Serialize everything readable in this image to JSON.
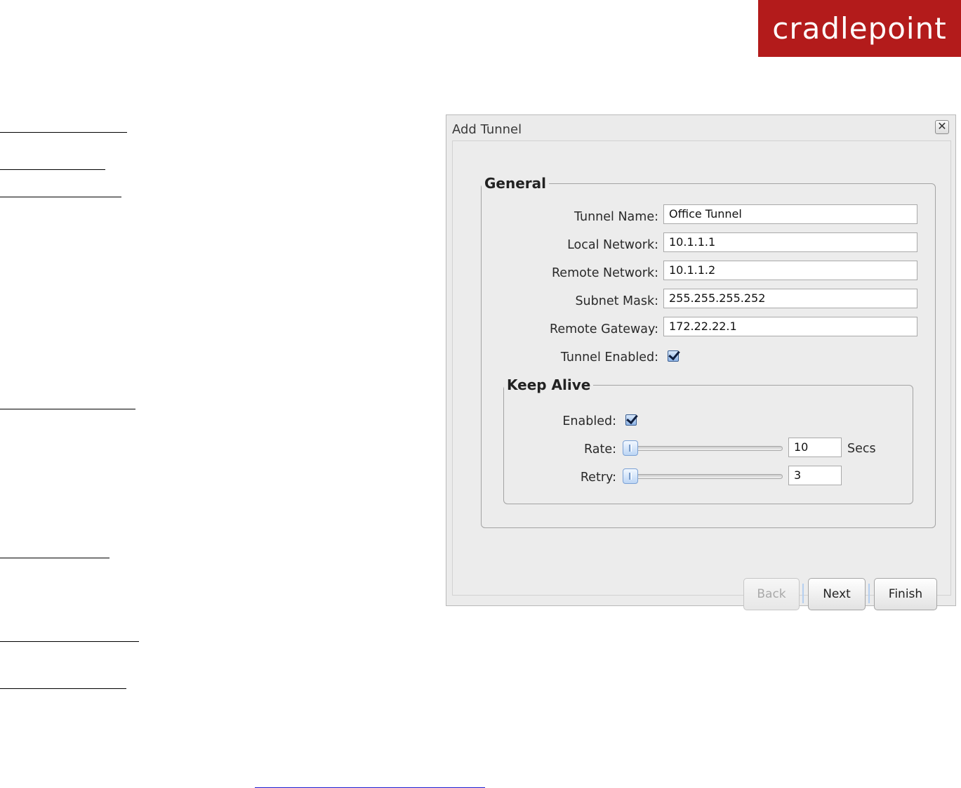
{
  "brand": {
    "logo_text": "cradlepoint",
    "color": "#b31b1b"
  },
  "dialog": {
    "title": "Add Tunnel",
    "close_icon": "close-icon",
    "general": {
      "legend": "General",
      "fields": [
        {
          "label": "Tunnel Name:",
          "value": "Office Tunnel"
        },
        {
          "label": "Local Network:",
          "value": "10.1.1.1"
        },
        {
          "label": "Remote Network:",
          "value": "10.1.1.2"
        },
        {
          "label": "Subnet Mask:",
          "value": "255.255.255.252"
        },
        {
          "label": "Remote Gateway:",
          "value": "172.22.22.1"
        }
      ],
      "tunnel_enabled": {
        "label": "Tunnel Enabled:",
        "checked": true
      }
    },
    "keep_alive": {
      "legend": "Keep Alive",
      "enabled": {
        "label": "Enabled:",
        "checked": true
      },
      "rate": {
        "label": "Rate:",
        "value": "10",
        "unit": "Secs"
      },
      "retry": {
        "label": "Retry:",
        "value": "3"
      }
    },
    "buttons": {
      "back": "Back",
      "next": "Next",
      "finish": "Finish"
    }
  }
}
